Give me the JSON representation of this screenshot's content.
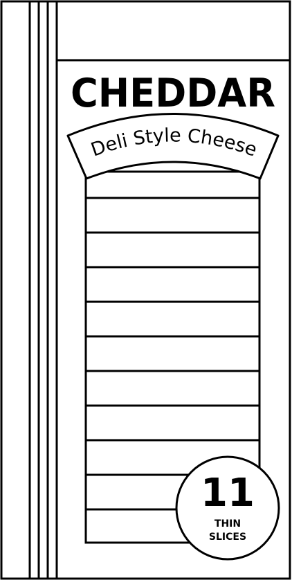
{
  "package": {
    "product_name": "CHEDDAR",
    "subtitle": "Deli Style Cheese",
    "badge": {
      "count": "11",
      "line1": "THIN",
      "line2": "SLICES"
    }
  },
  "colors": {
    "stroke": "#000000",
    "background": "#ffffff"
  }
}
